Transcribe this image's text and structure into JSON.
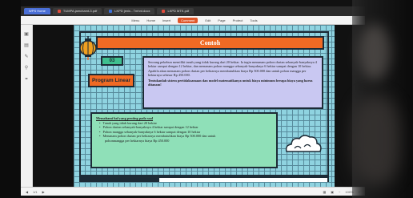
{
  "tabs": [
    {
      "label": "WPS Home",
      "color": "#4a6fd6"
    },
    {
      "label": "TUMPA.jamchamt-3.pdf",
      "color": "#e04a3a"
    },
    {
      "label": "LKPD jenis - Tmhnt.docx",
      "color": "#3b6fd8"
    },
    {
      "label": "LKPD MTK.pdf",
      "color": "#e04a3a"
    }
  ],
  "toolbar": {
    "menu": "Menu",
    "items": [
      "Home",
      "Insert",
      "Comment",
      "Edit",
      "Page",
      "Protect",
      "Tools"
    ],
    "active": "Comment"
  },
  "leftbar_icons": [
    "bookmark-icon",
    "thumbnail-icon",
    "annotation-icon",
    "search-icon",
    "attachment-icon"
  ],
  "slide": {
    "title": "Contoh",
    "number": "03",
    "program_label": "Program Linear",
    "problem_text": "Seorang pekebun memiliki tanah yang tidak kurang dari 20 hektar. Ia ingin menanam pohon durian sebanyak-banyaknya 4 hektar sampai dengan 12 hektar, dan menanam pohon mangga sebanyak-banyaknya 6 hektar sampai dengan 10 hektar. Apabila akan menanam pohon durian per hektarnya membutuhkan biaya Rp 500.000 dan untuk pohon mangga per hektarnya sebesar Rp 450.000.",
    "problem_question": "Tentukanlah sistem pertidaksamaan dan model matematikanya untuk biaya minimum berapa biaya yang harus ditanam!",
    "info_heading": "Memahami hal yang penting pada soal",
    "info_items": [
      "Tanah yang tidak kurang dari 20 hektar",
      "Pohon durian sebanyak-banyaknya 4 hektar sampai dengan 12 hektar",
      "Pohon mangga sebanyak-banyaknya 6 hektar sampai dengan 10 hektar",
      "Menanam pohon durian per hektarnya membutuhkan biaya Rp 500.000 dan untuk",
      "pohonmangga per hektarnya biaya Rp 450.000"
    ]
  },
  "statusbar": {
    "page": "1/1",
    "zoom": "100%"
  }
}
